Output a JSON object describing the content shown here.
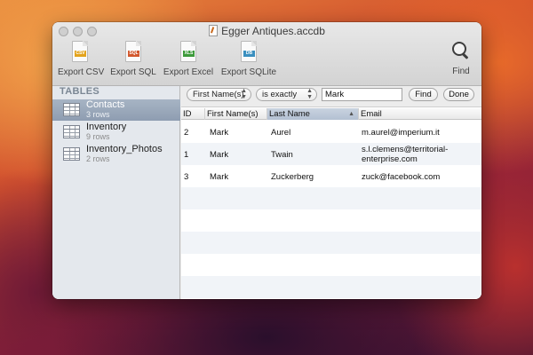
{
  "window": {
    "title": "Egger Antiques.accdb"
  },
  "toolbar": {
    "items": [
      {
        "label": "Export CSV",
        "tag": "CSV",
        "color": "#e3a31c",
        "icon": "csv-file-icon"
      },
      {
        "label": "Export SQL",
        "tag": "SQL",
        "color": "#d2572c",
        "icon": "sql-file-icon"
      },
      {
        "label": "Export Excel",
        "tag": "XLS",
        "color": "#3c9a3a",
        "icon": "excel-file-icon"
      },
      {
        "label": "Export SQLite",
        "tag": "DB",
        "color": "#3a8fbf",
        "icon": "sqlite-file-icon"
      }
    ],
    "find_label": "Find"
  },
  "sidebar": {
    "header": "TABLES",
    "items": [
      {
        "name": "Contacts",
        "rows": "3 rows",
        "selected": true
      },
      {
        "name": "Inventory",
        "rows": "9 rows",
        "selected": false
      },
      {
        "name": "Inventory_Photos",
        "rows": "2 rows",
        "selected": false
      }
    ]
  },
  "filter": {
    "field": "First Name(s)",
    "operator": "is exactly",
    "value": "Mark",
    "find_button": "Find",
    "done_button": "Done"
  },
  "table": {
    "columns": [
      "ID",
      "First Name(s)",
      "Last Name",
      "Email"
    ],
    "sorted_column": "Last Name",
    "rows": [
      {
        "id": "2",
        "first": "Mark",
        "last": "Aurel",
        "email": [
          "m.aurel@imperium.it"
        ]
      },
      {
        "id": "1",
        "first": "Mark",
        "last": "Twain",
        "email": [
          "s.l.clemens@territorial-",
          "enterprise.com"
        ]
      },
      {
        "id": "3",
        "first": "Mark",
        "last": "Zuckerberg",
        "email": [
          "zuck@facebook.com"
        ]
      }
    ]
  },
  "colors": {
    "selection": "#99a8bb",
    "stripe": "#f1f4f8"
  }
}
